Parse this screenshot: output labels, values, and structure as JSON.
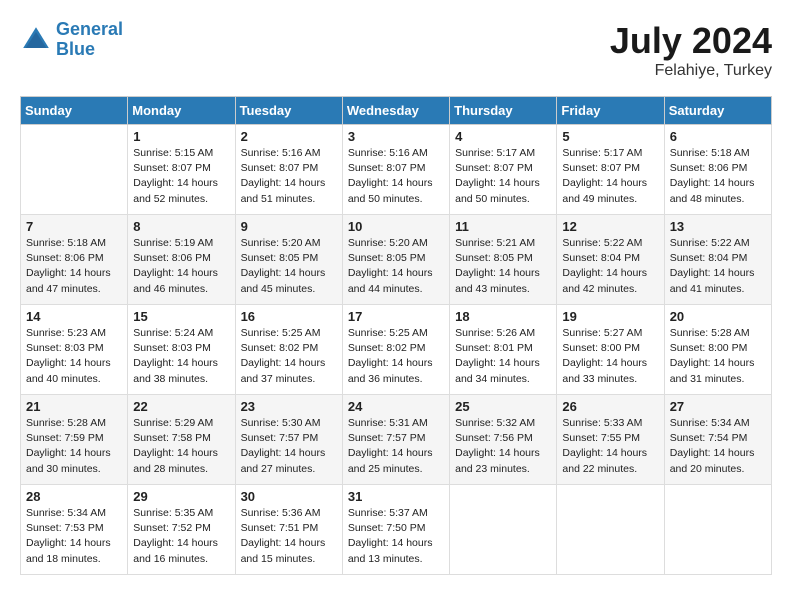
{
  "header": {
    "logo_line1": "General",
    "logo_line2": "Blue",
    "month": "July 2024",
    "location": "Felahiye, Turkey"
  },
  "days_of_week": [
    "Sunday",
    "Monday",
    "Tuesday",
    "Wednesday",
    "Thursday",
    "Friday",
    "Saturday"
  ],
  "weeks": [
    [
      {
        "day": "",
        "sunrise": "",
        "sunset": "",
        "daylight": ""
      },
      {
        "day": "1",
        "sunrise": "Sunrise: 5:15 AM",
        "sunset": "Sunset: 8:07 PM",
        "daylight": "Daylight: 14 hours and 52 minutes."
      },
      {
        "day": "2",
        "sunrise": "Sunrise: 5:16 AM",
        "sunset": "Sunset: 8:07 PM",
        "daylight": "Daylight: 14 hours and 51 minutes."
      },
      {
        "day": "3",
        "sunrise": "Sunrise: 5:16 AM",
        "sunset": "Sunset: 8:07 PM",
        "daylight": "Daylight: 14 hours and 50 minutes."
      },
      {
        "day": "4",
        "sunrise": "Sunrise: 5:17 AM",
        "sunset": "Sunset: 8:07 PM",
        "daylight": "Daylight: 14 hours and 50 minutes."
      },
      {
        "day": "5",
        "sunrise": "Sunrise: 5:17 AM",
        "sunset": "Sunset: 8:07 PM",
        "daylight": "Daylight: 14 hours and 49 minutes."
      },
      {
        "day": "6",
        "sunrise": "Sunrise: 5:18 AM",
        "sunset": "Sunset: 8:06 PM",
        "daylight": "Daylight: 14 hours and 48 minutes."
      }
    ],
    [
      {
        "day": "7",
        "sunrise": "Sunrise: 5:18 AM",
        "sunset": "Sunset: 8:06 PM",
        "daylight": "Daylight: 14 hours and 47 minutes."
      },
      {
        "day": "8",
        "sunrise": "Sunrise: 5:19 AM",
        "sunset": "Sunset: 8:06 PM",
        "daylight": "Daylight: 14 hours and 46 minutes."
      },
      {
        "day": "9",
        "sunrise": "Sunrise: 5:20 AM",
        "sunset": "Sunset: 8:05 PM",
        "daylight": "Daylight: 14 hours and 45 minutes."
      },
      {
        "day": "10",
        "sunrise": "Sunrise: 5:20 AM",
        "sunset": "Sunset: 8:05 PM",
        "daylight": "Daylight: 14 hours and 44 minutes."
      },
      {
        "day": "11",
        "sunrise": "Sunrise: 5:21 AM",
        "sunset": "Sunset: 8:05 PM",
        "daylight": "Daylight: 14 hours and 43 minutes."
      },
      {
        "day": "12",
        "sunrise": "Sunrise: 5:22 AM",
        "sunset": "Sunset: 8:04 PM",
        "daylight": "Daylight: 14 hours and 42 minutes."
      },
      {
        "day": "13",
        "sunrise": "Sunrise: 5:22 AM",
        "sunset": "Sunset: 8:04 PM",
        "daylight": "Daylight: 14 hours and 41 minutes."
      }
    ],
    [
      {
        "day": "14",
        "sunrise": "Sunrise: 5:23 AM",
        "sunset": "Sunset: 8:03 PM",
        "daylight": "Daylight: 14 hours and 40 minutes."
      },
      {
        "day": "15",
        "sunrise": "Sunrise: 5:24 AM",
        "sunset": "Sunset: 8:03 PM",
        "daylight": "Daylight: 14 hours and 38 minutes."
      },
      {
        "day": "16",
        "sunrise": "Sunrise: 5:25 AM",
        "sunset": "Sunset: 8:02 PM",
        "daylight": "Daylight: 14 hours and 37 minutes."
      },
      {
        "day": "17",
        "sunrise": "Sunrise: 5:25 AM",
        "sunset": "Sunset: 8:02 PM",
        "daylight": "Daylight: 14 hours and 36 minutes."
      },
      {
        "day": "18",
        "sunrise": "Sunrise: 5:26 AM",
        "sunset": "Sunset: 8:01 PM",
        "daylight": "Daylight: 14 hours and 34 minutes."
      },
      {
        "day": "19",
        "sunrise": "Sunrise: 5:27 AM",
        "sunset": "Sunset: 8:00 PM",
        "daylight": "Daylight: 14 hours and 33 minutes."
      },
      {
        "day": "20",
        "sunrise": "Sunrise: 5:28 AM",
        "sunset": "Sunset: 8:00 PM",
        "daylight": "Daylight: 14 hours and 31 minutes."
      }
    ],
    [
      {
        "day": "21",
        "sunrise": "Sunrise: 5:28 AM",
        "sunset": "Sunset: 7:59 PM",
        "daylight": "Daylight: 14 hours and 30 minutes."
      },
      {
        "day": "22",
        "sunrise": "Sunrise: 5:29 AM",
        "sunset": "Sunset: 7:58 PM",
        "daylight": "Daylight: 14 hours and 28 minutes."
      },
      {
        "day": "23",
        "sunrise": "Sunrise: 5:30 AM",
        "sunset": "Sunset: 7:57 PM",
        "daylight": "Daylight: 14 hours and 27 minutes."
      },
      {
        "day": "24",
        "sunrise": "Sunrise: 5:31 AM",
        "sunset": "Sunset: 7:57 PM",
        "daylight": "Daylight: 14 hours and 25 minutes."
      },
      {
        "day": "25",
        "sunrise": "Sunrise: 5:32 AM",
        "sunset": "Sunset: 7:56 PM",
        "daylight": "Daylight: 14 hours and 23 minutes."
      },
      {
        "day": "26",
        "sunrise": "Sunrise: 5:33 AM",
        "sunset": "Sunset: 7:55 PM",
        "daylight": "Daylight: 14 hours and 22 minutes."
      },
      {
        "day": "27",
        "sunrise": "Sunrise: 5:34 AM",
        "sunset": "Sunset: 7:54 PM",
        "daylight": "Daylight: 14 hours and 20 minutes."
      }
    ],
    [
      {
        "day": "28",
        "sunrise": "Sunrise: 5:34 AM",
        "sunset": "Sunset: 7:53 PM",
        "daylight": "Daylight: 14 hours and 18 minutes."
      },
      {
        "day": "29",
        "sunrise": "Sunrise: 5:35 AM",
        "sunset": "Sunset: 7:52 PM",
        "daylight": "Daylight: 14 hours and 16 minutes."
      },
      {
        "day": "30",
        "sunrise": "Sunrise: 5:36 AM",
        "sunset": "Sunset: 7:51 PM",
        "daylight": "Daylight: 14 hours and 15 minutes."
      },
      {
        "day": "31",
        "sunrise": "Sunrise: 5:37 AM",
        "sunset": "Sunset: 7:50 PM",
        "daylight": "Daylight: 14 hours and 13 minutes."
      },
      {
        "day": "",
        "sunrise": "",
        "sunset": "",
        "daylight": ""
      },
      {
        "day": "",
        "sunrise": "",
        "sunset": "",
        "daylight": ""
      },
      {
        "day": "",
        "sunrise": "",
        "sunset": "",
        "daylight": ""
      }
    ]
  ]
}
